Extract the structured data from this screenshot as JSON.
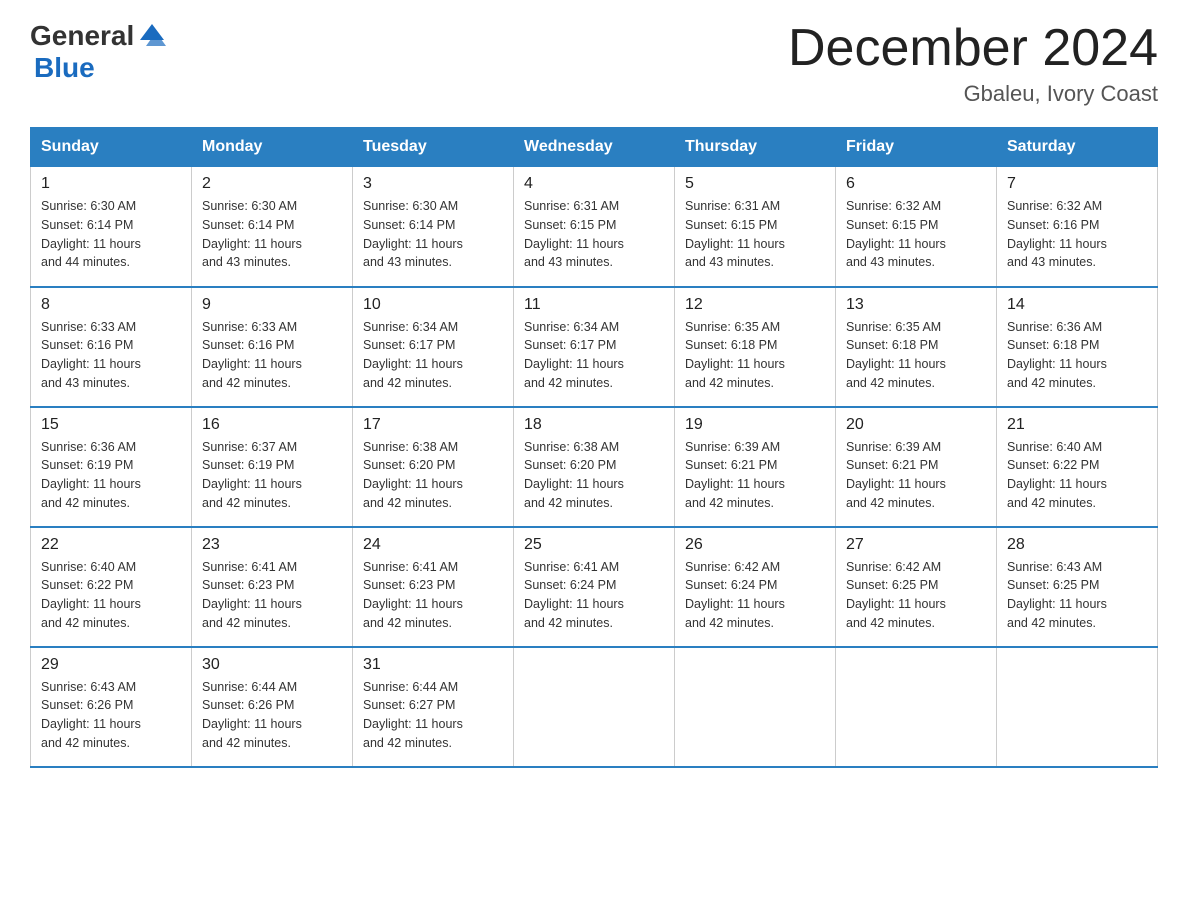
{
  "logo": {
    "text_general": "General",
    "text_blue": "Blue"
  },
  "calendar": {
    "title": "December 2024",
    "subtitle": "Gbaleu, Ivory Coast"
  },
  "headers": [
    "Sunday",
    "Monday",
    "Tuesday",
    "Wednesday",
    "Thursday",
    "Friday",
    "Saturday"
  ],
  "weeks": [
    [
      {
        "day": "1",
        "sunrise": "6:30 AM",
        "sunset": "6:14 PM",
        "daylight": "11 hours and 44 minutes."
      },
      {
        "day": "2",
        "sunrise": "6:30 AM",
        "sunset": "6:14 PM",
        "daylight": "11 hours and 43 minutes."
      },
      {
        "day": "3",
        "sunrise": "6:30 AM",
        "sunset": "6:14 PM",
        "daylight": "11 hours and 43 minutes."
      },
      {
        "day": "4",
        "sunrise": "6:31 AM",
        "sunset": "6:15 PM",
        "daylight": "11 hours and 43 minutes."
      },
      {
        "day": "5",
        "sunrise": "6:31 AM",
        "sunset": "6:15 PM",
        "daylight": "11 hours and 43 minutes."
      },
      {
        "day": "6",
        "sunrise": "6:32 AM",
        "sunset": "6:15 PM",
        "daylight": "11 hours and 43 minutes."
      },
      {
        "day": "7",
        "sunrise": "6:32 AM",
        "sunset": "6:16 PM",
        "daylight": "11 hours and 43 minutes."
      }
    ],
    [
      {
        "day": "8",
        "sunrise": "6:33 AM",
        "sunset": "6:16 PM",
        "daylight": "11 hours and 43 minutes."
      },
      {
        "day": "9",
        "sunrise": "6:33 AM",
        "sunset": "6:16 PM",
        "daylight": "11 hours and 42 minutes."
      },
      {
        "day": "10",
        "sunrise": "6:34 AM",
        "sunset": "6:17 PM",
        "daylight": "11 hours and 42 minutes."
      },
      {
        "day": "11",
        "sunrise": "6:34 AM",
        "sunset": "6:17 PM",
        "daylight": "11 hours and 42 minutes."
      },
      {
        "day": "12",
        "sunrise": "6:35 AM",
        "sunset": "6:18 PM",
        "daylight": "11 hours and 42 minutes."
      },
      {
        "day": "13",
        "sunrise": "6:35 AM",
        "sunset": "6:18 PM",
        "daylight": "11 hours and 42 minutes."
      },
      {
        "day": "14",
        "sunrise": "6:36 AM",
        "sunset": "6:18 PM",
        "daylight": "11 hours and 42 minutes."
      }
    ],
    [
      {
        "day": "15",
        "sunrise": "6:36 AM",
        "sunset": "6:19 PM",
        "daylight": "11 hours and 42 minutes."
      },
      {
        "day": "16",
        "sunrise": "6:37 AM",
        "sunset": "6:19 PM",
        "daylight": "11 hours and 42 minutes."
      },
      {
        "day": "17",
        "sunrise": "6:38 AM",
        "sunset": "6:20 PM",
        "daylight": "11 hours and 42 minutes."
      },
      {
        "day": "18",
        "sunrise": "6:38 AM",
        "sunset": "6:20 PM",
        "daylight": "11 hours and 42 minutes."
      },
      {
        "day": "19",
        "sunrise": "6:39 AM",
        "sunset": "6:21 PM",
        "daylight": "11 hours and 42 minutes."
      },
      {
        "day": "20",
        "sunrise": "6:39 AM",
        "sunset": "6:21 PM",
        "daylight": "11 hours and 42 minutes."
      },
      {
        "day": "21",
        "sunrise": "6:40 AM",
        "sunset": "6:22 PM",
        "daylight": "11 hours and 42 minutes."
      }
    ],
    [
      {
        "day": "22",
        "sunrise": "6:40 AM",
        "sunset": "6:22 PM",
        "daylight": "11 hours and 42 minutes."
      },
      {
        "day": "23",
        "sunrise": "6:41 AM",
        "sunset": "6:23 PM",
        "daylight": "11 hours and 42 minutes."
      },
      {
        "day": "24",
        "sunrise": "6:41 AM",
        "sunset": "6:23 PM",
        "daylight": "11 hours and 42 minutes."
      },
      {
        "day": "25",
        "sunrise": "6:41 AM",
        "sunset": "6:24 PM",
        "daylight": "11 hours and 42 minutes."
      },
      {
        "day": "26",
        "sunrise": "6:42 AM",
        "sunset": "6:24 PM",
        "daylight": "11 hours and 42 minutes."
      },
      {
        "day": "27",
        "sunrise": "6:42 AM",
        "sunset": "6:25 PM",
        "daylight": "11 hours and 42 minutes."
      },
      {
        "day": "28",
        "sunrise": "6:43 AM",
        "sunset": "6:25 PM",
        "daylight": "11 hours and 42 minutes."
      }
    ],
    [
      {
        "day": "29",
        "sunrise": "6:43 AM",
        "sunset": "6:26 PM",
        "daylight": "11 hours and 42 minutes."
      },
      {
        "day": "30",
        "sunrise": "6:44 AM",
        "sunset": "6:26 PM",
        "daylight": "11 hours and 42 minutes."
      },
      {
        "day": "31",
        "sunrise": "6:44 AM",
        "sunset": "6:27 PM",
        "daylight": "11 hours and 42 minutes."
      },
      null,
      null,
      null,
      null
    ]
  ]
}
